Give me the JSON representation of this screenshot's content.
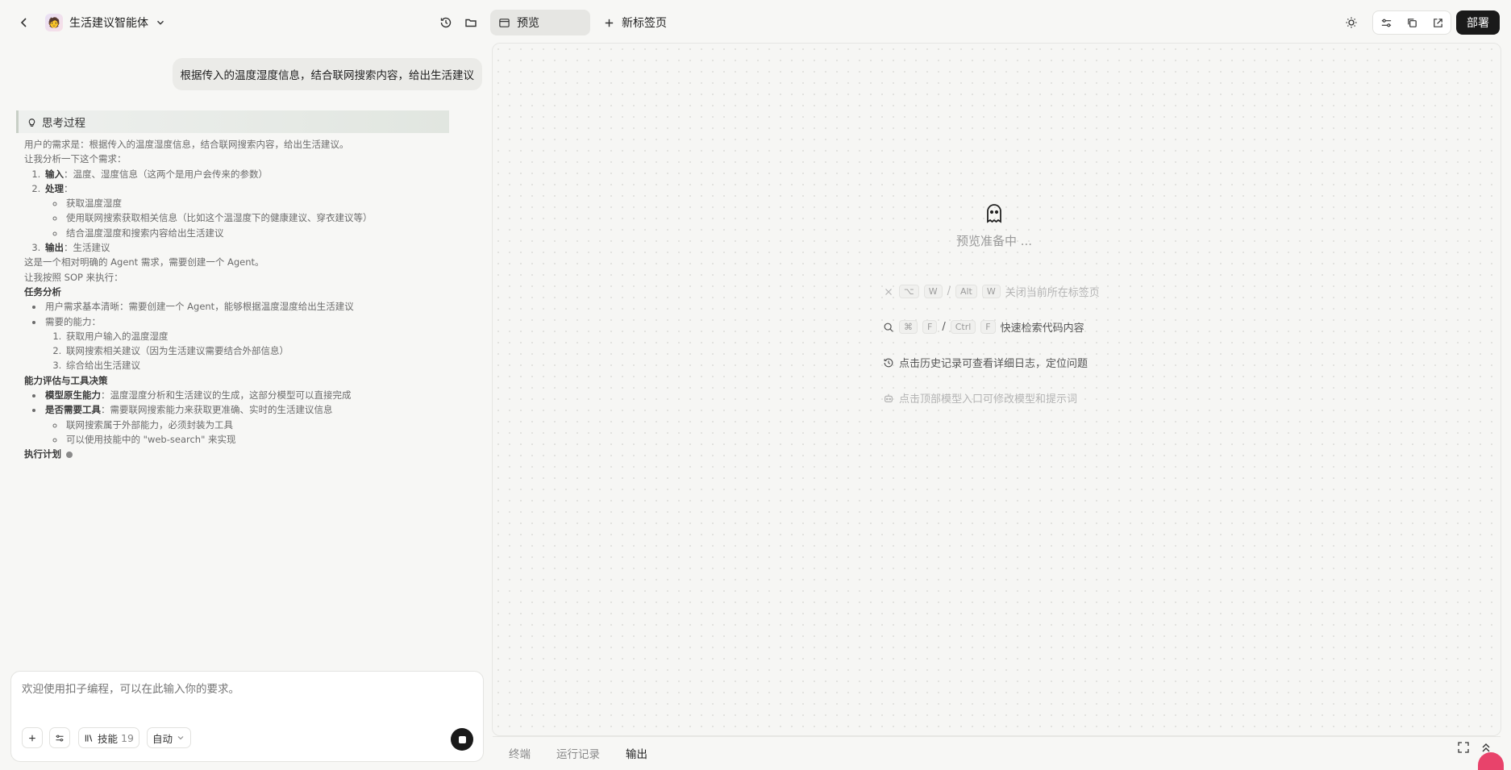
{
  "header": {
    "app_name": "生活建议智能体",
    "tab_preview": "预览",
    "tab_new": "新标签页",
    "deploy": "部署"
  },
  "chat": {
    "user_message": "根据传入的温度湿度信息，结合联网搜索内容，给出生活建议",
    "thinking_title": "思考过程",
    "lines": {
      "p1": "用户的需求是：根据传入的温度湿度信息，结合联网搜索内容，给出生活建议。",
      "p2": "让我分析一下这个需求：",
      "i1_label": "输入",
      "i1_text": "：温度、湿度信息（这两个是用户会传来的参数）",
      "i2_label": "处理",
      "i2_text": "：",
      "i2_s1": "获取温度湿度",
      "i2_s2": "使用联网搜索获取相关信息（比如这个温湿度下的健康建议、穿衣建议等）",
      "i2_s3": "结合温度湿度和搜索内容给出生活建议",
      "i3_label": "输出",
      "i3_text": "：生活建议",
      "p3": "这是一个相对明确的 Agent 需求，需要创建一个 Agent。",
      "p4": "让我按照 SOP 来执行：",
      "h1": "任务分析",
      "t1": "用户需求基本清晰：需要创建一个 Agent，能够根据温度湿度给出生活建议",
      "t2": "需要的能力：",
      "t2_s1": "获取用户输入的温度湿度",
      "t2_s2": "联网搜索相关建议（因为生活建议需要结合外部信息）",
      "t2_s3": "综合给出生活建议",
      "h2": "能力评估与工具决策",
      "c1_label": "模型原生能力",
      "c1_text": "：温度湿度分析和生活建议的生成，这部分模型可以直接完成",
      "c2_label": "是否需要工具",
      "c2_text": "：需要联网搜索能力来获取更准确、实时的生活建议信息",
      "c2_s1": "联网搜索属于外部能力，必须封装为工具",
      "c2_s2": "可以使用技能中的 \"web-search\" 来实现",
      "h3": "执行计划"
    }
  },
  "composer": {
    "placeholder": "欢迎使用扣子编程，可以在此输入你的要求。",
    "skills_label": "技能",
    "skills_count": "19",
    "mode": "自动"
  },
  "preview": {
    "status": "预览准备中 ...",
    "hints": [
      {
        "keys": [
          "⌥",
          "W",
          "/",
          "Alt",
          "W"
        ],
        "text": "关闭当前所在标签页"
      },
      {
        "keys": [
          "⌘",
          "F",
          "/",
          "Ctrl",
          "F"
        ],
        "text": "快速检索代码内容"
      },
      {
        "keys": [],
        "text": "点击历史记录可查看详细日志，定位问题"
      },
      {
        "keys": [],
        "text": "点击顶部模型入口可修改模型和提示词"
      }
    ]
  },
  "bottom_tabs": [
    "终端",
    "运行记录",
    "输出"
  ]
}
